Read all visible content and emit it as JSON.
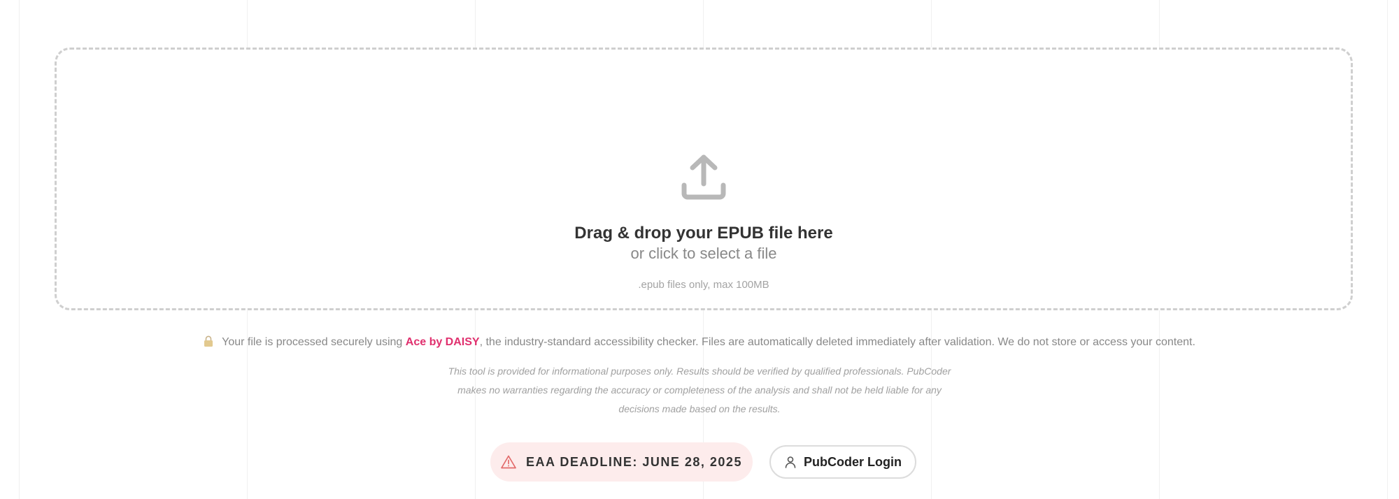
{
  "dropzone": {
    "title": "Drag & drop your EPUB file here",
    "subtitle": "or click to select a file",
    "hint": ".epub files only, max 100MB",
    "icon": "upload-icon"
  },
  "security": {
    "icon": "lock-icon",
    "prefix": "Your file is processed securely using ",
    "link_label": "Ace by DAISY",
    "suffix": ", the industry-standard accessibility checker. Files are automatically deleted immediately after validation. We do not store or access your content."
  },
  "disclaimer": {
    "text": "This tool is provided for informational purposes only. Results should be verified by qualified professionals. PubCoder makes no warranties regarding the accuracy or completeness of the analysis and shall not be held liable for any decisions made based on the results."
  },
  "deadline": {
    "icon": "warning-icon",
    "label": "EAA DEADLINE: JUNE 28, 2025"
  },
  "login": {
    "icon": "user-icon",
    "label": "PubCoder Login"
  },
  "colors": {
    "accent": "#e0306e",
    "deadline_bg": "#fdecec",
    "deadline_icon": "#e26a6a",
    "muted_text": "#888888",
    "dropzone_border": "#cfcfcf"
  }
}
